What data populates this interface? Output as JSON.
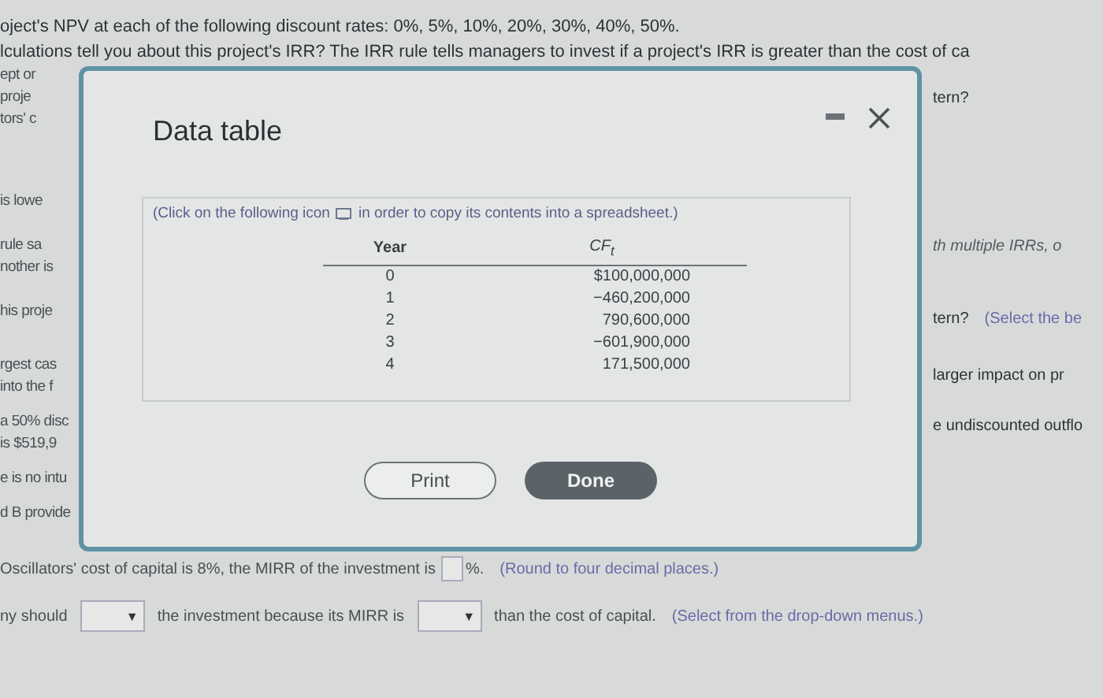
{
  "page": {
    "top_lines": [
      "oject's NPV at each of the following discount rates: 0%, 5%, 10%, 20%, 30%, 40%, 50%.",
      "lculations tell you about this project's IRR? The IRR rule tells managers to invest if a project's IRR is greater than the cost of ca"
    ],
    "left_fragments": [
      [
        "ept or",
        "proje",
        "tors' c"
      ],
      [
        "is lowe"
      ],
      [
        "rule sa",
        "nother is"
      ],
      [
        "his proje"
      ],
      [
        "rgest cas",
        "into the f"
      ],
      [
        "a 50% disc",
        "is $519,9"
      ],
      [
        "e is no intu"
      ],
      [
        "d B provide"
      ]
    ],
    "right_fragments": [
      [
        {
          "kind": "plain",
          "text": "tern?"
        }
      ],
      [
        {
          "kind": "italic",
          "text": "th multiple IRRs, o"
        }
      ],
      [
        {
          "kind": "plain",
          "text": "tern?"
        },
        {
          "kind": "hint",
          "text": "(Select the be"
        }
      ],
      [
        {
          "kind": "plain",
          "text": "larger impact on pr"
        }
      ],
      [
        {
          "kind": "plain",
          "text": "e undiscounted outflo"
        }
      ]
    ],
    "question_1": {
      "before": "Oscillators' cost of capital is 8%, the MIRR of the investment is",
      "after": "%.",
      "hint": "(Round to four decimal places.)"
    },
    "question_2": {
      "before": "ny should",
      "dropdown_1": "▼",
      "middle": "the investment because its MIRR is",
      "dropdown_2": "▼",
      "after": "than the cost of capital.",
      "hint": "(Select from the drop-down menus.)"
    }
  },
  "modal": {
    "title": "Data table",
    "instruction_before": "(Click on the following icon",
    "instruction_after": "in order to copy its contents into a spreadsheet.)",
    "columns": [
      "Year",
      "CF$_{t}$"
    ],
    "rows": [
      [
        "0",
        "$100,000,000"
      ],
      [
        "1",
        "−460,200,000"
      ],
      [
        "2",
        "790,600,000"
      ],
      [
        "3",
        "−601,900,000"
      ],
      [
        "4",
        "171,500,000"
      ]
    ],
    "buttons": [
      {
        "kind": "outline",
        "label": "Print"
      },
      {
        "kind": "filled",
        "label": "Done"
      }
    ]
  }
}
